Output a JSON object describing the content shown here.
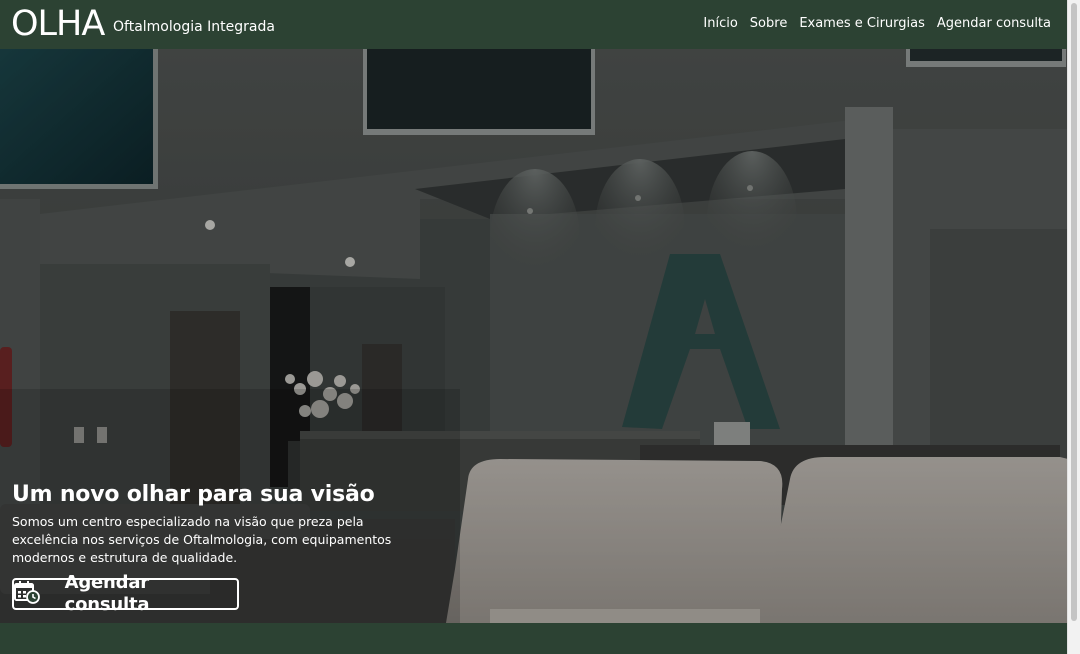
{
  "brand": {
    "logo": "OLHA",
    "subtitle": "Oftalmologia Integrada"
  },
  "nav": {
    "items": [
      "Início",
      "Sobre",
      "Exames e Cirurgias",
      "Agendar consulta"
    ]
  },
  "hero": {
    "title": "Um novo olhar para sua visão",
    "description": "Somos um centro especializado na visão que preza pela excelência nos serviços de Oftalmologia, com equipamentos modernos e estrutura de qualidade.",
    "cta_label": "Agendar consulta",
    "cta_icon": "calendar-clock-icon"
  },
  "colors": {
    "header_bg": "#2c4233",
    "footer_bg": "#2c4233",
    "text": "#ffffff"
  }
}
